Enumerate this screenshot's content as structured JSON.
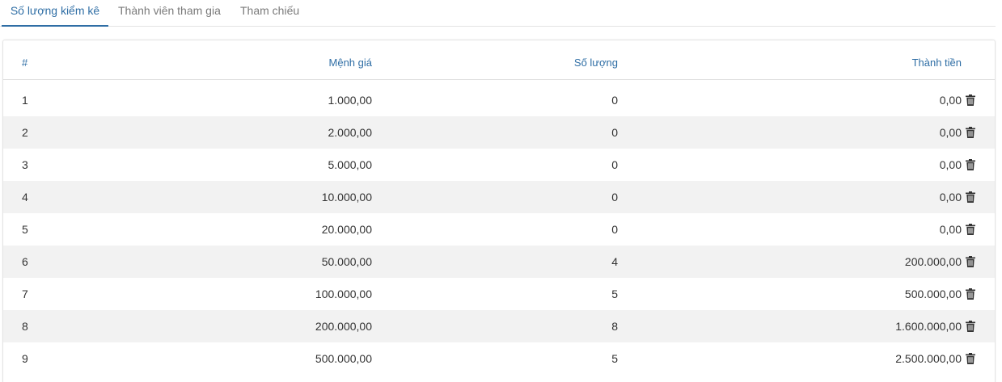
{
  "tabs": [
    {
      "label": "Số lượng kiểm kê",
      "active": true
    },
    {
      "label": "Thành viên tham gia",
      "active": false
    },
    {
      "label": "Tham chiếu",
      "active": false
    }
  ],
  "table": {
    "headers": {
      "index": "#",
      "denomination": "Mệnh giá",
      "quantity": "Số lượng",
      "total": "Thành tiền"
    },
    "rows": [
      {
        "index": "1",
        "denomination": "1.000,00",
        "quantity": "0",
        "total": "0,00"
      },
      {
        "index": "2",
        "denomination": "2.000,00",
        "quantity": "0",
        "total": "0,00"
      },
      {
        "index": "3",
        "denomination": "5.000,00",
        "quantity": "0",
        "total": "0,00"
      },
      {
        "index": "4",
        "denomination": "10.000,00",
        "quantity": "0",
        "total": "0,00"
      },
      {
        "index": "5",
        "denomination": "20.000,00",
        "quantity": "0",
        "total": "0,00"
      },
      {
        "index": "6",
        "denomination": "50.000,00",
        "quantity": "4",
        "total": "200.000,00"
      },
      {
        "index": "7",
        "denomination": "100.000,00",
        "quantity": "5",
        "total": "500.000,00"
      },
      {
        "index": "8",
        "denomination": "200.000,00",
        "quantity": "8",
        "total": "1.600.000,00"
      },
      {
        "index": "9",
        "denomination": "500.000,00",
        "quantity": "5",
        "total": "2.500.000,00"
      }
    ],
    "row_action_icon": "trash-icon"
  },
  "colors": {
    "accent": "#2f6ea5",
    "tab_inactive": "#7a7a7a",
    "row_shade": "#f2f2f2",
    "text": "#333333"
  }
}
